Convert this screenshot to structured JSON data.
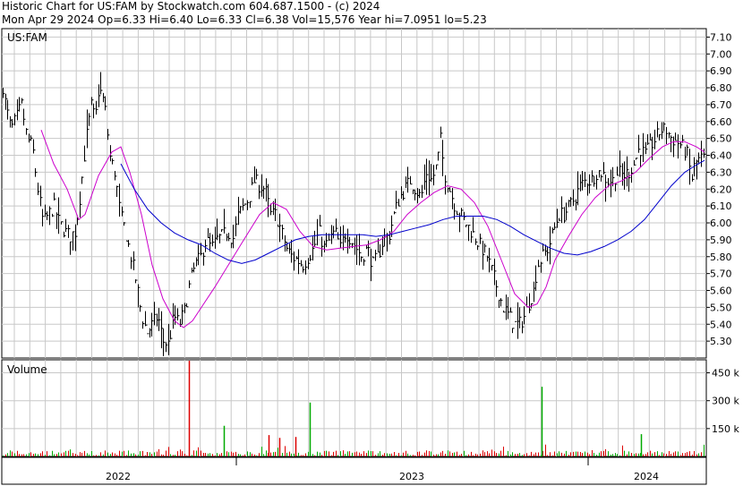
{
  "header": {
    "line1": "Historic Chart for US:FAM by Stockwatch.com 604.687.1500 - (c) 2024",
    "line2": "Mon Apr 29 2024  Op=6.33  Hi=6.40  Lo=6.33  Cl=6.38  Vol=15,576  Year hi=7.0951  lo=5.23"
  },
  "chart_data": [
    {
      "type": "candlestick",
      "title": "US:FAM",
      "ylim": [
        5.2,
        7.15
      ],
      "y_ticks": [
        "7.10",
        "7.00",
        "6.90",
        "6.80",
        "6.70",
        "6.60",
        "6.50",
        "6.40",
        "6.30",
        "6.20",
        "6.10",
        "6.00",
        "5.90",
        "5.80",
        "5.70",
        "5.60",
        "5.50",
        "5.40",
        "5.30"
      ],
      "x_ticks": [
        "2022",
        "2023",
        "2024"
      ],
      "grid": true,
      "colors": {
        "price": "#000000",
        "ma_fast": "#cc00cc",
        "ma_slow": "#0000cc",
        "grid": "#c8c8c8"
      },
      "close_path": [
        [
          0,
          6.92
        ],
        [
          6,
          6.7
        ],
        [
          12,
          6.55
        ],
        [
          18,
          6.62
        ],
        [
          24,
          6.7
        ],
        [
          30,
          6.5
        ],
        [
          36,
          6.45
        ],
        [
          42,
          6.2
        ],
        [
          48,
          6.0
        ],
        [
          54,
          6.05
        ],
        [
          60,
          6.1
        ],
        [
          66,
          6.0
        ],
        [
          72,
          5.95
        ],
        [
          78,
          5.92
        ],
        [
          84,
          5.95
        ],
        [
          90,
          6.2
        ],
        [
          96,
          6.5
        ],
        [
          102,
          6.7
        ],
        [
          106,
          6.6
        ],
        [
          110,
          6.8
        ],
        [
          114,
          6.75
        ],
        [
          118,
          6.65
        ],
        [
          122,
          6.4
        ],
        [
          128,
          6.3
        ],
        [
          134,
          6.05
        ],
        [
          140,
          5.95
        ],
        [
          146,
          5.8
        ],
        [
          152,
          5.65
        ],
        [
          158,
          5.45
        ],
        [
          164,
          5.35
        ],
        [
          170,
          5.4
        ],
        [
          176,
          5.45
        ],
        [
          182,
          5.3
        ],
        [
          188,
          5.28
        ],
        [
          194,
          5.45
        ],
        [
          200,
          5.4
        ],
        [
          206,
          5.48
        ],
        [
          212,
          5.65
        ],
        [
          218,
          5.75
        ],
        [
          224,
          5.8
        ],
        [
          230,
          5.9
        ],
        [
          236,
          5.85
        ],
        [
          242,
          5.9
        ],
        [
          248,
          5.92
        ],
        [
          254,
          5.95
        ],
        [
          260,
          5.9
        ],
        [
          266,
          6.05
        ],
        [
          272,
          6.1
        ],
        [
          278,
          6.15
        ],
        [
          284,
          6.25
        ],
        [
          290,
          6.22
        ],
        [
          296,
          6.2
        ],
        [
          302,
          6.05
        ],
        [
          308,
          6.05
        ],
        [
          314,
          5.95
        ],
        [
          320,
          5.85
        ],
        [
          326,
          5.8
        ],
        [
          332,
          5.78
        ],
        [
          338,
          5.75
        ],
        [
          344,
          5.8
        ],
        [
          350,
          5.85
        ],
        [
          356,
          5.95
        ],
        [
          362,
          5.85
        ],
        [
          368,
          5.9
        ],
        [
          374,
          5.95
        ],
        [
          380,
          5.85
        ],
        [
          386,
          5.95
        ],
        [
          392,
          5.9
        ],
        [
          398,
          5.85
        ],
        [
          404,
          5.8
        ],
        [
          410,
          5.85
        ],
        [
          416,
          5.75
        ],
        [
          422,
          5.8
        ],
        [
          428,
          5.9
        ],
        [
          434,
          5.92
        ],
        [
          440,
          6.05
        ],
        [
          446,
          6.15
        ],
        [
          452,
          6.2
        ],
        [
          458,
          6.25
        ],
        [
          464,
          6.2
        ],
        [
          470,
          6.15
        ],
        [
          476,
          6.3
        ],
        [
          482,
          6.25
        ],
        [
          488,
          6.35
        ],
        [
          492,
          6.5
        ],
        [
          496,
          6.3
        ],
        [
          502,
          6.2
        ],
        [
          508,
          6.1
        ],
        [
          514,
          6.05
        ],
        [
          520,
          6.0
        ],
        [
          526,
          5.95
        ],
        [
          532,
          5.9
        ],
        [
          538,
          5.85
        ],
        [
          544,
          5.8
        ],
        [
          550,
          5.7
        ],
        [
          556,
          5.6
        ],
        [
          562,
          5.5
        ],
        [
          568,
          5.45
        ],
        [
          574,
          5.4
        ],
        [
          580,
          5.4
        ],
        [
          586,
          5.45
        ],
        [
          592,
          5.55
        ],
        [
          596,
          5.6
        ],
        [
          600,
          5.75
        ],
        [
          606,
          5.8
        ],
        [
          612,
          5.85
        ],
        [
          618,
          5.95
        ],
        [
          624,
          6.05
        ],
        [
          630,
          6.05
        ],
        [
          636,
          6.1
        ],
        [
          642,
          6.15
        ],
        [
          648,
          6.22
        ],
        [
          654,
          6.25
        ],
        [
          660,
          6.25
        ],
        [
          666,
          6.3
        ],
        [
          672,
          6.3
        ],
        [
          678,
          6.25
        ],
        [
          684,
          6.25
        ],
        [
          690,
          6.3
        ],
        [
          696,
          6.28
        ],
        [
          702,
          6.3
        ],
        [
          708,
          6.35
        ],
        [
          714,
          6.45
        ],
        [
          720,
          6.4
        ],
        [
          726,
          6.45
        ],
        [
          732,
          6.5
        ],
        [
          738,
          6.55
        ],
        [
          744,
          6.55
        ],
        [
          750,
          6.5
        ],
        [
          756,
          6.48
        ],
        [
          762,
          6.45
        ],
        [
          768,
          6.4
        ],
        [
          772,
          6.25
        ],
        [
          776,
          6.35
        ],
        [
          782,
          6.38
        ]
      ],
      "ma_fast": [
        [
          46,
          6.55
        ],
        [
          60,
          6.35
        ],
        [
          75,
          6.2
        ],
        [
          88,
          6.02
        ],
        [
          95,
          6.05
        ],
        [
          110,
          6.28
        ],
        [
          125,
          6.42
        ],
        [
          135,
          6.45
        ],
        [
          145,
          6.3
        ],
        [
          158,
          6.05
        ],
        [
          170,
          5.75
        ],
        [
          182,
          5.55
        ],
        [
          195,
          5.42
        ],
        [
          205,
          5.38
        ],
        [
          215,
          5.42
        ],
        [
          225,
          5.5
        ],
        [
          240,
          5.62
        ],
        [
          255,
          5.75
        ],
        [
          270,
          5.88
        ],
        [
          290,
          6.05
        ],
        [
          305,
          6.12
        ],
        [
          320,
          6.08
        ],
        [
          335,
          5.95
        ],
        [
          350,
          5.86
        ],
        [
          365,
          5.84
        ],
        [
          380,
          5.85
        ],
        [
          395,
          5.86
        ],
        [
          410,
          5.87
        ],
        [
          425,
          5.9
        ],
        [
          440,
          5.95
        ],
        [
          455,
          6.05
        ],
        [
          470,
          6.12
        ],
        [
          485,
          6.18
        ],
        [
          500,
          6.22
        ],
        [
          515,
          6.2
        ],
        [
          530,
          6.12
        ],
        [
          545,
          5.98
        ],
        [
          560,
          5.78
        ],
        [
          575,
          5.58
        ],
        [
          590,
          5.5
        ],
        [
          600,
          5.52
        ],
        [
          610,
          5.62
        ],
        [
          620,
          5.78
        ],
        [
          635,
          5.92
        ],
        [
          650,
          6.05
        ],
        [
          665,
          6.15
        ],
        [
          680,
          6.22
        ],
        [
          695,
          6.25
        ],
        [
          710,
          6.3
        ],
        [
          725,
          6.38
        ],
        [
          740,
          6.45
        ],
        [
          752,
          6.48
        ],
        [
          765,
          6.48
        ],
        [
          778,
          6.45
        ],
        [
          787,
          6.42
        ]
      ],
      "ma_slow": [
        [
          135,
          6.35
        ],
        [
          150,
          6.2
        ],
        [
          165,
          6.08
        ],
        [
          180,
          6.0
        ],
        [
          195,
          5.94
        ],
        [
          210,
          5.9
        ],
        [
          225,
          5.87
        ],
        [
          240,
          5.82
        ],
        [
          255,
          5.78
        ],
        [
          270,
          5.76
        ],
        [
          285,
          5.78
        ],
        [
          300,
          5.82
        ],
        [
          315,
          5.86
        ],
        [
          330,
          5.9
        ],
        [
          345,
          5.92
        ],
        [
          360,
          5.93
        ],
        [
          375,
          5.93
        ],
        [
          390,
          5.93
        ],
        [
          405,
          5.93
        ],
        [
          420,
          5.92
        ],
        [
          435,
          5.93
        ],
        [
          450,
          5.95
        ],
        [
          465,
          5.97
        ],
        [
          480,
          5.99
        ],
        [
          495,
          6.02
        ],
        [
          510,
          6.04
        ],
        [
          525,
          6.04
        ],
        [
          540,
          6.04
        ],
        [
          555,
          6.02
        ],
        [
          570,
          5.98
        ],
        [
          585,
          5.93
        ],
        [
          600,
          5.89
        ],
        [
          615,
          5.85
        ],
        [
          630,
          5.82
        ],
        [
          645,
          5.81
        ],
        [
          660,
          5.83
        ],
        [
          675,
          5.86
        ],
        [
          690,
          5.9
        ],
        [
          705,
          5.95
        ],
        [
          720,
          6.02
        ],
        [
          735,
          6.12
        ],
        [
          750,
          6.22
        ],
        [
          765,
          6.3
        ],
        [
          780,
          6.35
        ],
        [
          787,
          6.37
        ]
      ]
    },
    {
      "type": "bar",
      "title": "Volume",
      "ylim": [
        0,
        520
      ],
      "y_ticks": [
        "450 k",
        "300 k",
        "150 k"
      ],
      "x_ticks": [
        "2022",
        "2023",
        "2024"
      ],
      "colors": {
        "down": "#dd0000",
        "up": "#00aa00"
      },
      "spikes": [
        [
          211,
          540,
          "down"
        ],
        [
          250,
          165,
          "up"
        ],
        [
          300,
          115,
          "down"
        ],
        [
          346,
          290,
          "up"
        ],
        [
          605,
          375,
          "up"
        ],
        [
          716,
          120,
          "up"
        ],
        [
          312,
          100,
          "down"
        ],
        [
          330,
          105,
          "down"
        ]
      ]
    }
  ]
}
